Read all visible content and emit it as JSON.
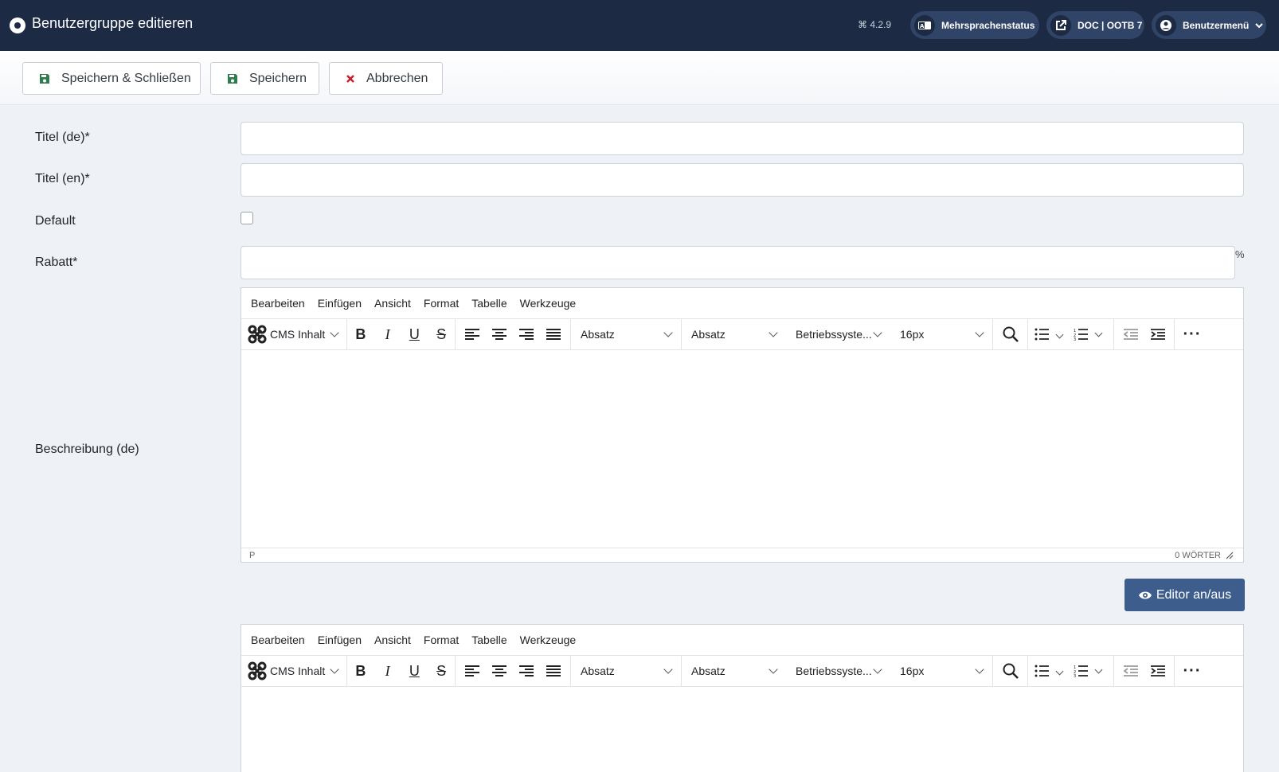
{
  "header": {
    "title": "Benutzergruppe editieren",
    "version": "4.2.9",
    "buttons": {
      "multilang": "Mehrsprachenstatus",
      "site": "DOC | OOTB 7",
      "user_menu": "Benutzermenü"
    }
  },
  "toolbar": {
    "save_close": "Speichern & Schließen",
    "save": "Speichern",
    "cancel": "Abbrechen"
  },
  "form": {
    "title_de": {
      "label": "Titel (de)*",
      "value": ""
    },
    "title_en": {
      "label": "Titel (en)*",
      "value": ""
    },
    "default": {
      "label": "Default",
      "checked": false
    },
    "discount": {
      "label": "Rabatt*",
      "value": "",
      "unit": "%"
    },
    "description_de": {
      "label": "Beschreibung (de)"
    }
  },
  "editor": {
    "menu": [
      "Bearbeiten",
      "Einfügen",
      "Ansicht",
      "Format",
      "Tabelle",
      "Werkzeuge"
    ],
    "cms_content": "CMS Inhalt",
    "block_format_1": "Absatz",
    "block_format_2": "Absatz",
    "font_family": "Betriebssyste...",
    "font_size": "16px",
    "path": "P",
    "word_count": "0 WÖRTER"
  },
  "toggle_editor": "Editor an/aus",
  "colors": {
    "header_bg": "#1c2a43",
    "pill_bg": "#2f4467",
    "save_icon": "#2e7d4f",
    "cancel_icon": "#c8202f",
    "toggle_bg": "#3d5e8c"
  }
}
